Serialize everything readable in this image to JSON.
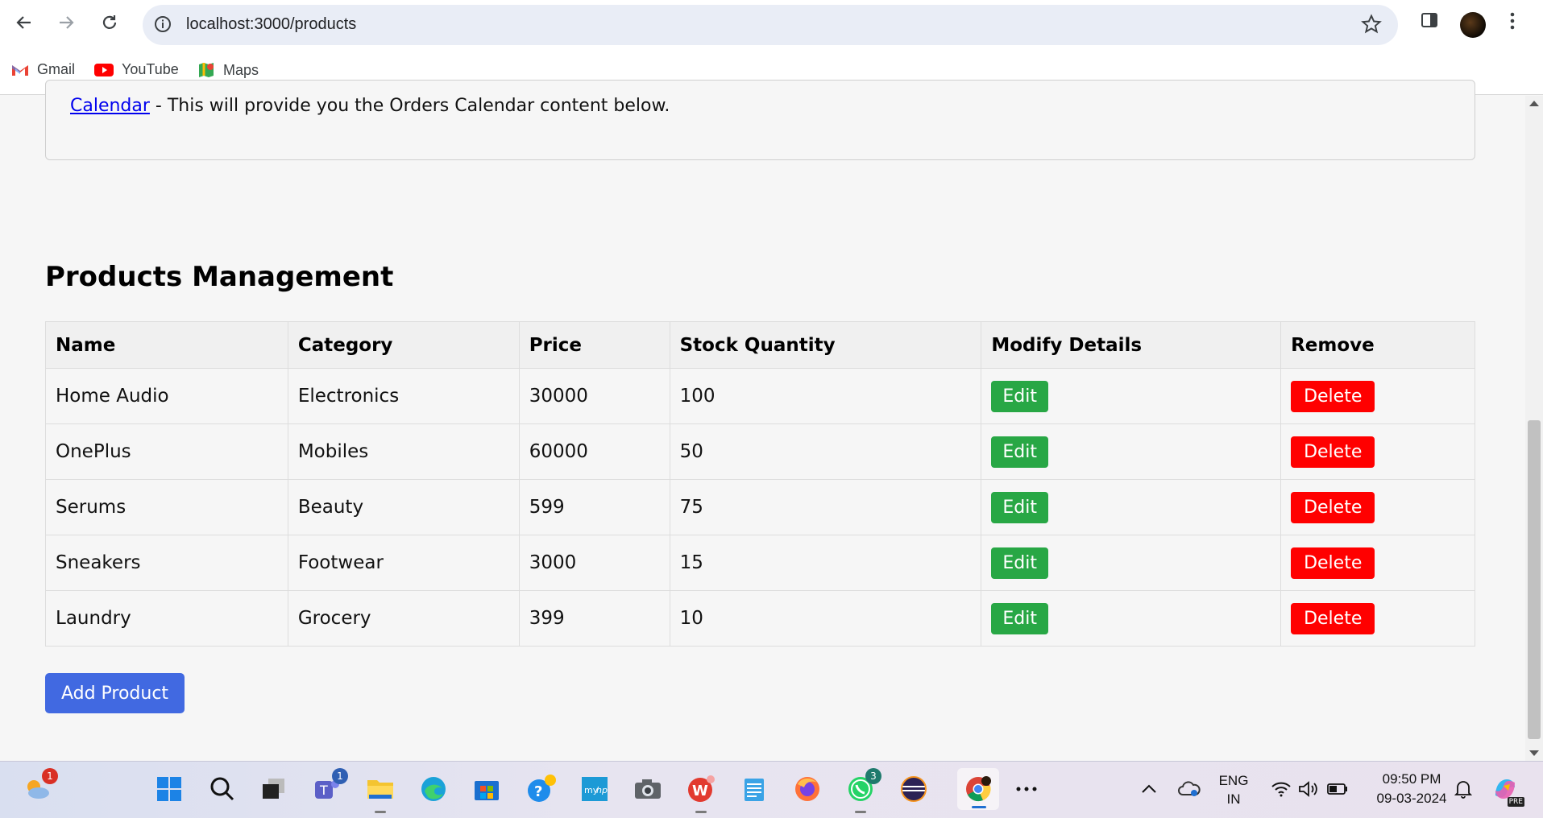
{
  "browser": {
    "url": "localhost:3000/products",
    "bookmarks": [
      {
        "label": "Gmail"
      },
      {
        "label": "YouTube"
      },
      {
        "label": "Maps"
      }
    ]
  },
  "page": {
    "calendar_link": "Calendar",
    "calendar_text": " - This will provide you the Orders Calendar content below.",
    "section_title": "Products Management",
    "table": {
      "headers": [
        "Name",
        "Category",
        "Price",
        "Stock Quantity",
        "Modify Details",
        "Remove"
      ],
      "rows": [
        {
          "name": "Home Audio",
          "category": "Electronics",
          "price": "30000",
          "stock": "100"
        },
        {
          "name": "OnePlus",
          "category": "Mobiles",
          "price": "60000",
          "stock": "50"
        },
        {
          "name": "Serums",
          "category": "Beauty",
          "price": "599",
          "stock": "75"
        },
        {
          "name": "Sneakers",
          "category": "Footwear",
          "price": "3000",
          "stock": "15"
        },
        {
          "name": "Laundry",
          "category": "Grocery",
          "price": "399",
          "stock": "10"
        }
      ],
      "edit_label": "Edit",
      "delete_label": "Delete"
    },
    "add_button": "Add Product"
  },
  "taskbar": {
    "weather_badge": "1",
    "teams_badge": "1",
    "whatsapp_badge": "3",
    "language": "ENG",
    "region": "IN",
    "time": "09:50 PM",
    "date": "09-03-2024",
    "copilot_tag": "PRE"
  },
  "colors": {
    "edit": "#28a745",
    "delete": "#ff0000",
    "add": "#4169e1",
    "link": "#0000ee"
  }
}
